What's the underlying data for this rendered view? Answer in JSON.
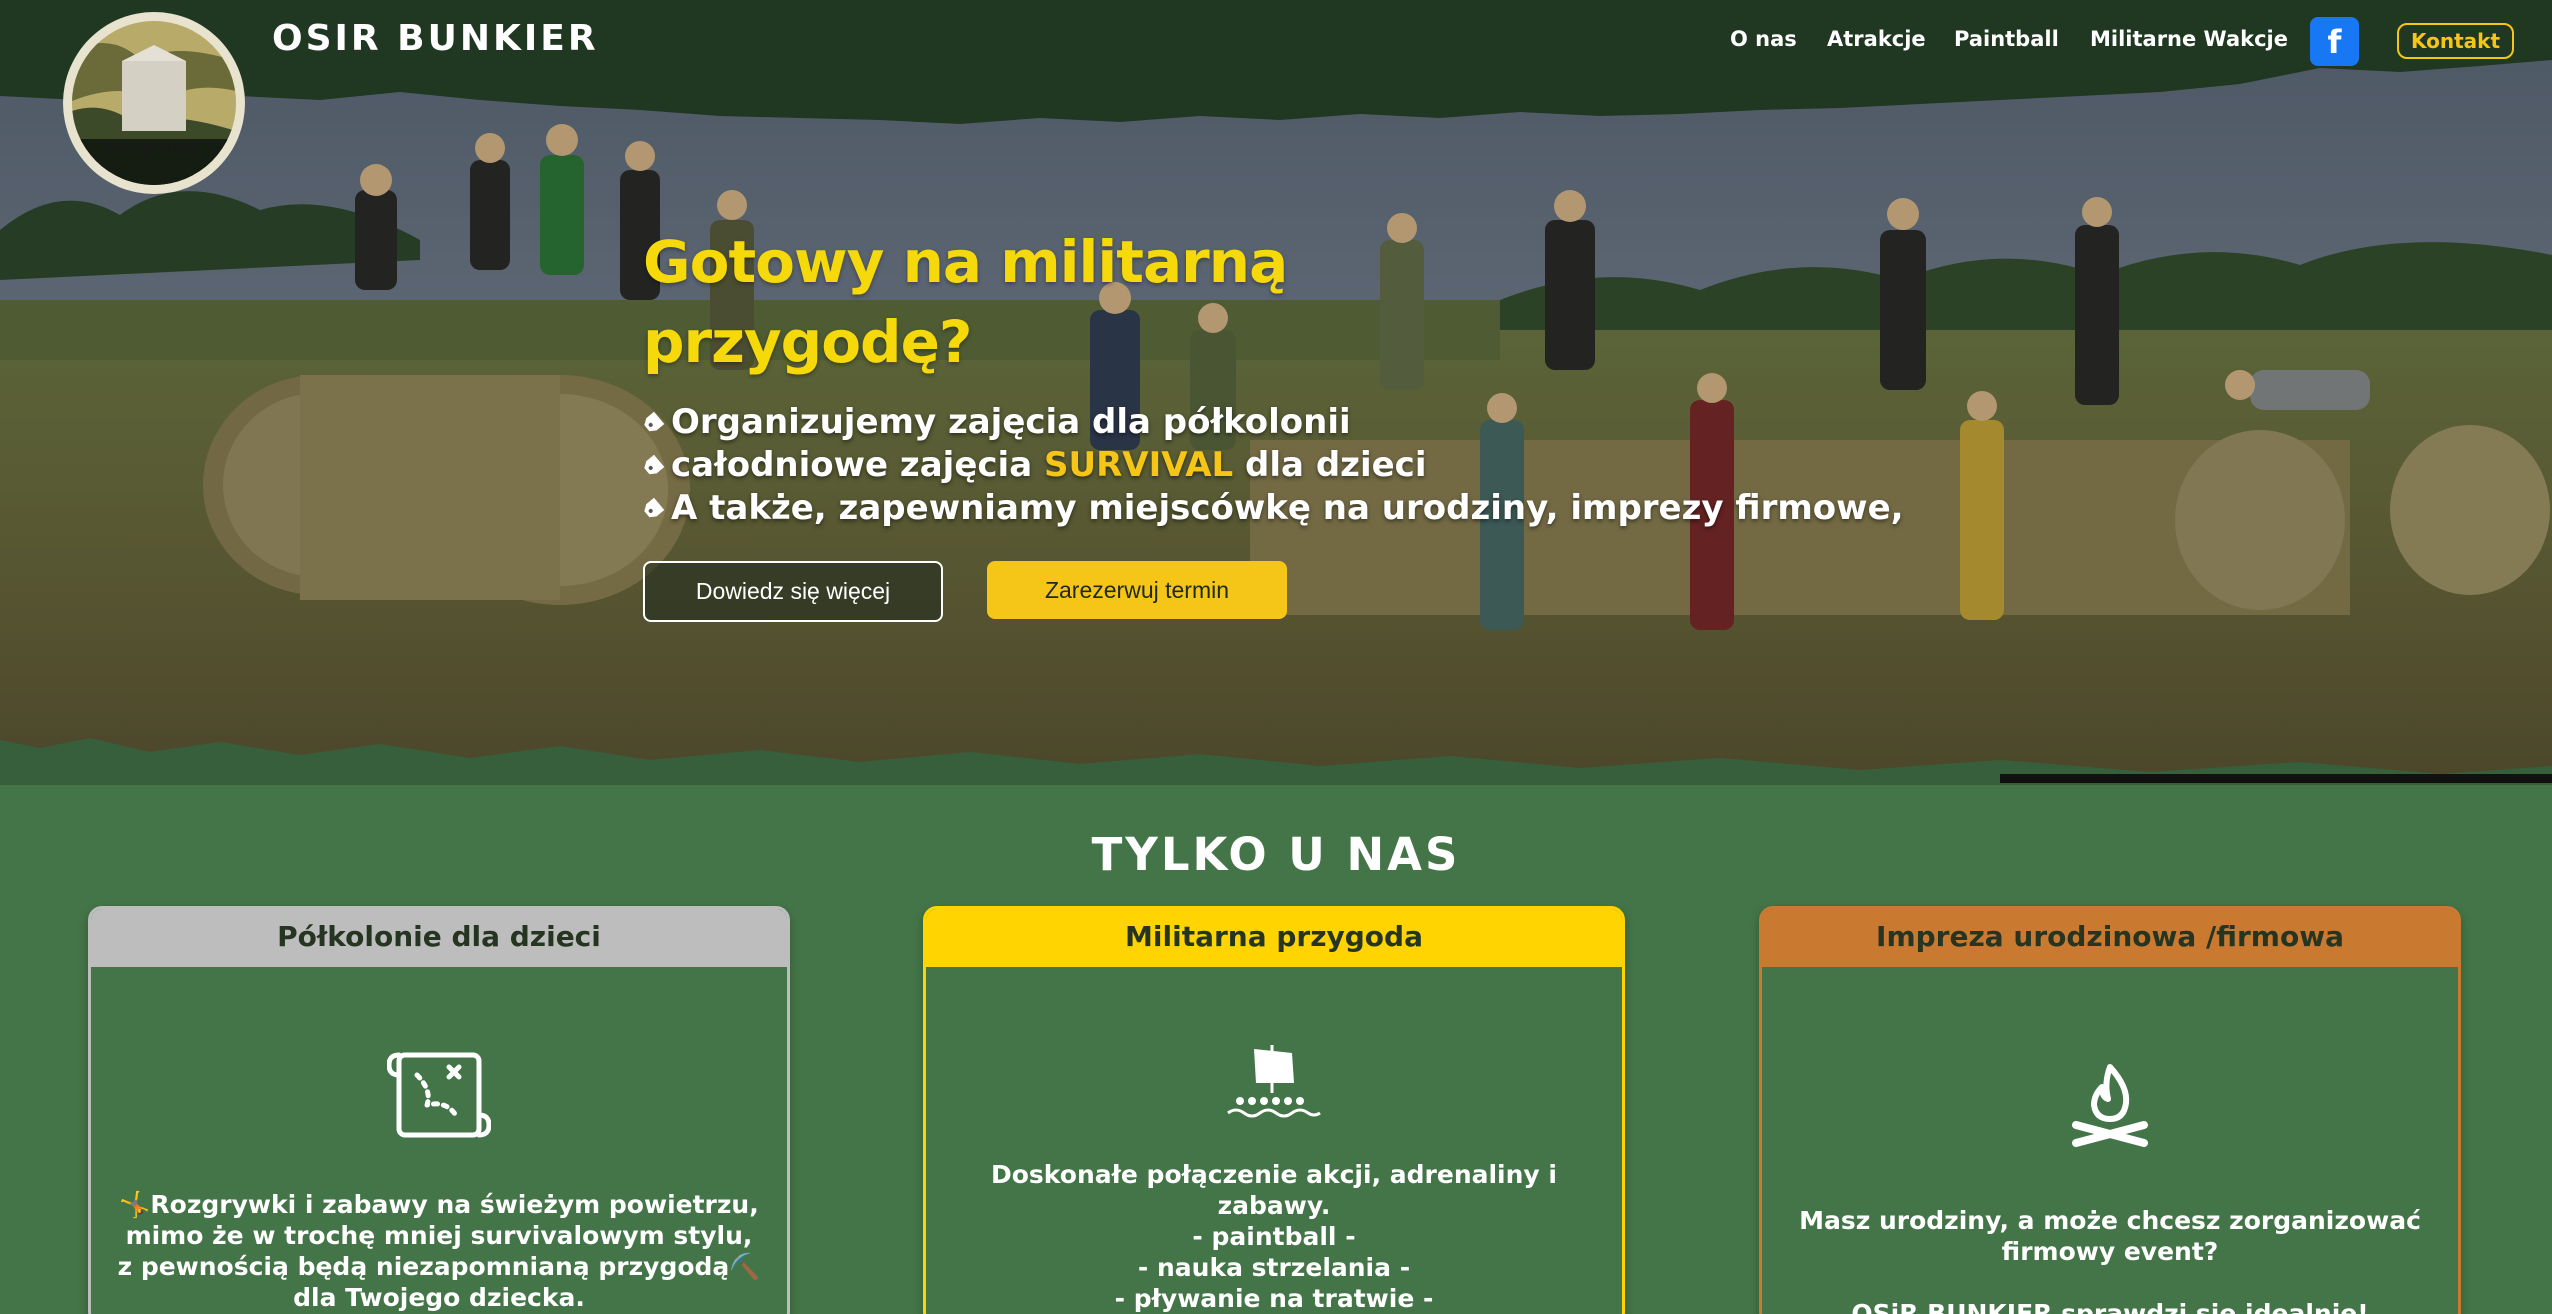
{
  "site": {
    "title": "OSIR BUNKIER",
    "logo_text": "OSIR BUNKIER"
  },
  "nav": {
    "items": [
      "O nas",
      "Atrakcje",
      "Paintball",
      "Militarne Wakcje"
    ],
    "facebook_label": "f",
    "contact_label": "Kontakt"
  },
  "hero": {
    "headline_line1": "Gotowy na militarną",
    "headline_line2": "przygodę?",
    "bullet1": "Organizujemy zajęcia dla półkolonii",
    "bullet2_before": "całodniowe zajęcia ",
    "bullet2_highlight": "SURVIVAL",
    "bullet2_after": " dla dzieci",
    "bullet3": "A także, zapewniamy miejscówkę na urodziny, imprezy firmowe,",
    "btn_more": "Dowiedz się więcej",
    "btn_book": "Zarezerwuj termin"
  },
  "section": {
    "title": "TYLKO U NAS"
  },
  "cards": [
    {
      "title": "Półkolonie dla dzieci",
      "icon": "treasure-map-icon",
      "accent": "#bdbdbd",
      "lines": [
        "🤸Rozgrywki i zabawy na świeżym powietrzu,",
        "mimo że w trochę mniej survivalowym stylu,",
        "z pewnością będą niezapomnianą przygodą⛏️",
        "dla Twojego dziecka."
      ]
    },
    {
      "title": "Militarna przygoda",
      "icon": "raft-icon",
      "accent": "#ffd400",
      "lines": [
        "Doskonałe połączenie akcji, adrenaliny i",
        "zabawy.",
        "- paintball -",
        "- nauka strzelania -",
        "- pływanie na tratwie -"
      ]
    },
    {
      "title": "Impreza urodzinowa /firmowa",
      "icon": "campfire-icon",
      "accent": "#c97a30",
      "lines": [
        "Masz urodziny, a może chcesz zorganizować",
        "firmowy event?",
        "",
        "OSiR BUNKIER sprawdzi się idealnie!"
      ]
    }
  ],
  "colors": {
    "brand_dark": "#203822",
    "section_bg": "#447548",
    "yellow": "#f5c518",
    "facebook": "#1877f2"
  }
}
